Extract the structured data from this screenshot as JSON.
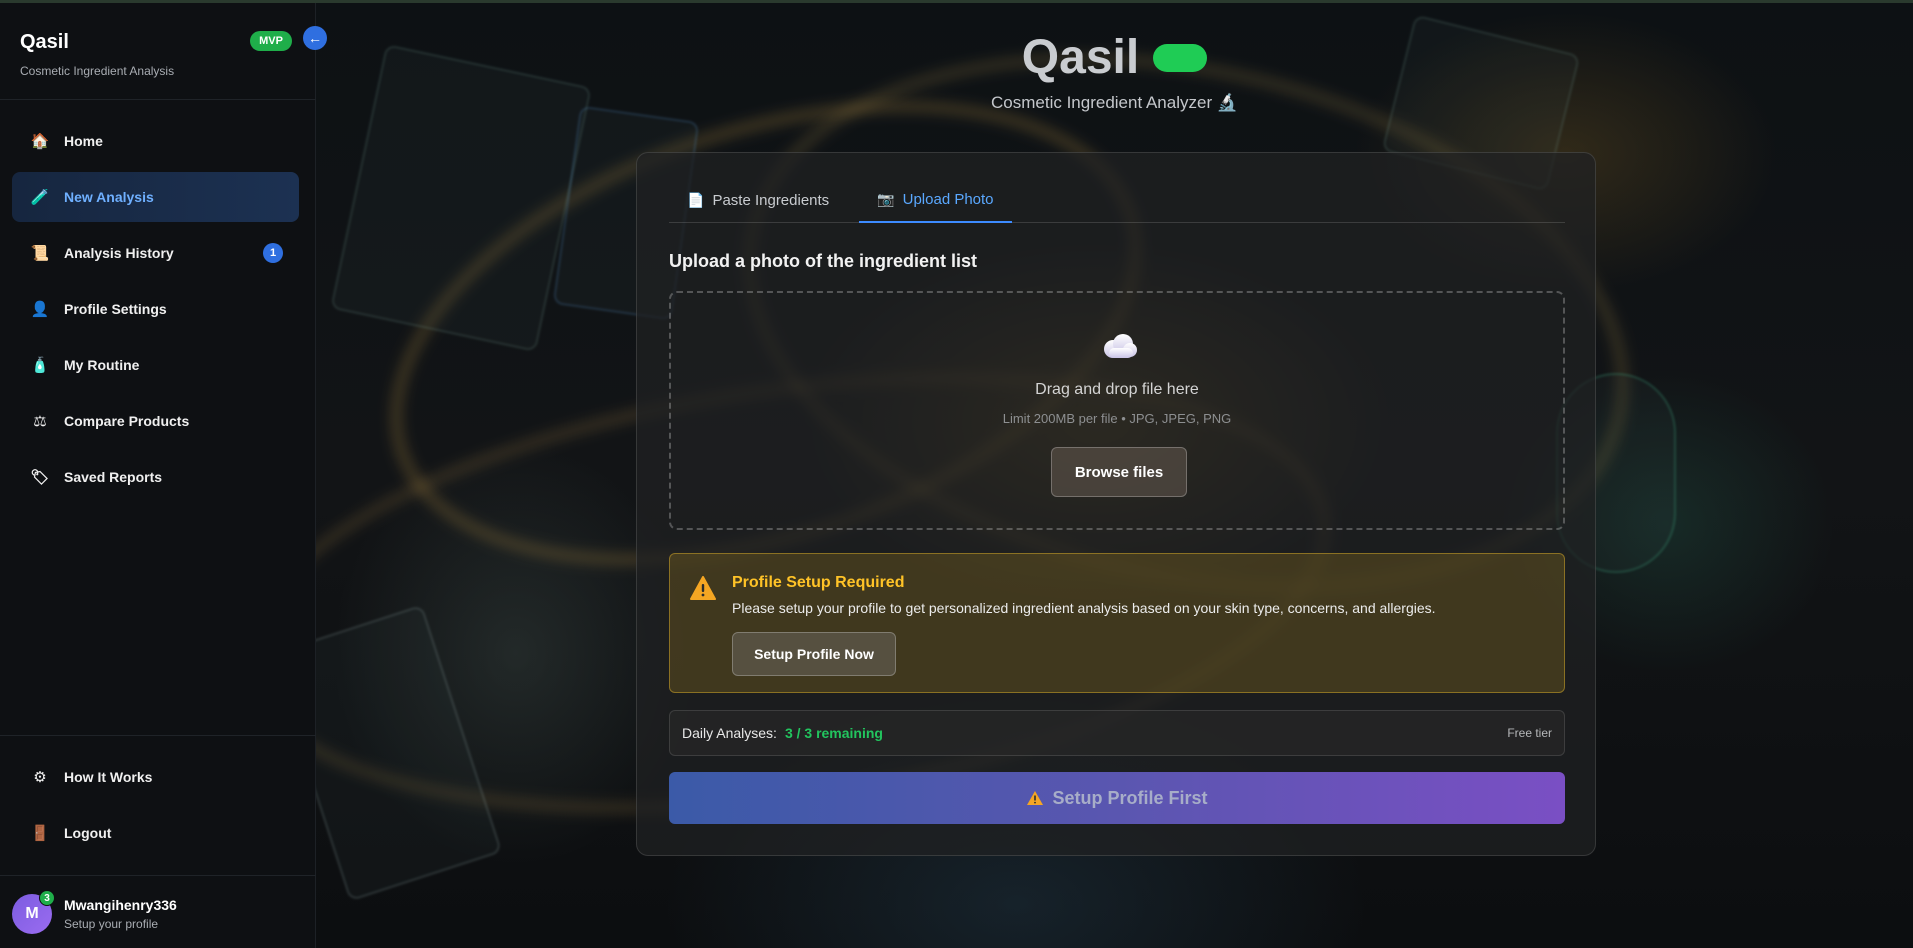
{
  "app": {
    "name": "Qasil",
    "subtitle": "Cosmetic Ingredient Analysis",
    "badge": "MVP"
  },
  "sidebar": {
    "collapse_icon": "arrow-left-icon",
    "items": [
      {
        "label": "Home",
        "icon": "house-icon"
      },
      {
        "label": "New Analysis",
        "icon": "test-tube-icon",
        "active": true
      },
      {
        "label": "Analysis History",
        "icon": "scroll-icon",
        "count": "1"
      },
      {
        "label": "Profile Settings",
        "icon": "person-icon"
      },
      {
        "label": "My Routine",
        "icon": "lotion-bottle-icon"
      },
      {
        "label": "Compare Products",
        "icon": "scales-icon"
      },
      {
        "label": "Saved Reports",
        "icon": "tag-icon"
      }
    ],
    "bottom_items": [
      {
        "label": "How It Works",
        "icon": "gear-icon"
      },
      {
        "label": "Logout",
        "icon": "door-icon"
      }
    ],
    "user": {
      "initial": "M",
      "notifications": "3",
      "name": "Mwangihenry336",
      "subtitle": "Setup your profile"
    }
  },
  "header": {
    "title": "Qasil",
    "subtitle": "Cosmetic Ingredient Analyzer 🔬"
  },
  "tabs": [
    {
      "label": "Paste Ingredients",
      "icon": "document-icon"
    },
    {
      "label": "Upload Photo",
      "icon": "camera-icon",
      "active": true
    }
  ],
  "upload": {
    "heading": "Upload a photo of the ingredient list",
    "drop_text": "Drag and drop file here",
    "limit_text": "Limit 200MB per file • JPG, JPEG, PNG",
    "browse_label": "Browse files"
  },
  "warning": {
    "title": "Profile Setup Required",
    "text": "Please setup your profile to get personalized ingredient analysis based on your skin type, concerns, and allergies.",
    "button": "Setup Profile Now"
  },
  "quota": {
    "label": "Daily Analyses:",
    "value": "3 / 3 remaining",
    "tier": "Free tier"
  },
  "cta": {
    "label": "Setup Profile First"
  },
  "colors": {
    "accent": "#3d8bff",
    "success": "#22c55e",
    "warning": "#ffc327",
    "mvp": "#1fae4a"
  }
}
